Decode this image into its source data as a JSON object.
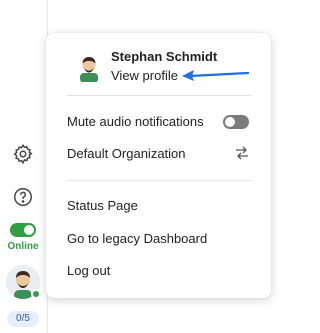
{
  "rail": {
    "settings_icon": "gear-icon",
    "help_icon": "help-circle-icon",
    "status_label": "Online",
    "status_on": true,
    "counter_label": "0/5"
  },
  "menu": {
    "user_name": "Stephan Schmidt",
    "view_profile_label": "View profile",
    "mute_label": "Mute audio notifications",
    "mute_on": false,
    "default_org_label": "Default Organization",
    "status_page_label": "Status Page",
    "legacy_label": "Go to legacy Dashboard",
    "logout_label": "Log out"
  },
  "colors": {
    "accent_blue": "#1f6fe5",
    "online_green": "#2f9e44",
    "toggle_off": "#7b7b7b"
  }
}
